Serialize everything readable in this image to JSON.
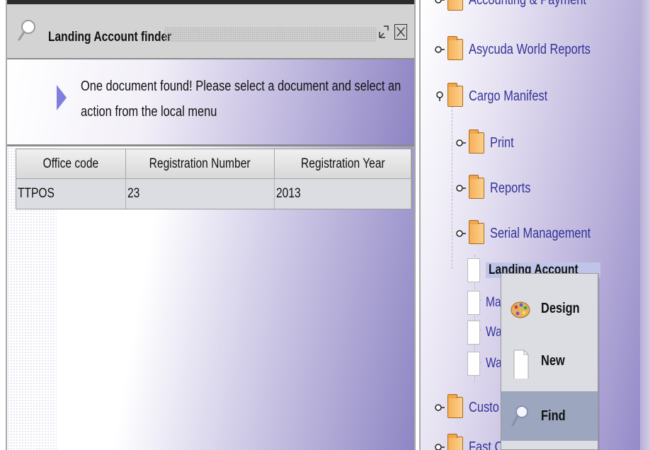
{
  "finder": {
    "title": "Landing Account finder",
    "message": "One document found! Please select a document and select an action from the local menu",
    "columns": [
      "Office code",
      "Registration Number",
      "Registration Year"
    ],
    "rows": [
      [
        "TTPOS",
        "23",
        "2013"
      ]
    ]
  },
  "tree": {
    "items": [
      {
        "label": "Accounting & Payment"
      },
      {
        "label": "Asycuda World Reports"
      },
      {
        "label": "Cargo Manifest"
      },
      {
        "label": "Print"
      },
      {
        "label": "Reports"
      },
      {
        "label": "Serial Management"
      },
      {
        "label": "Landing Account"
      },
      {
        "label": "Ma"
      },
      {
        "label": "Wa"
      },
      {
        "label": "Wa"
      },
      {
        "label": "Custo"
      },
      {
        "label": "Fast C"
      }
    ]
  },
  "context_menu": {
    "items": [
      {
        "label": "Design",
        "icon": "palette-icon"
      },
      {
        "label": "New",
        "icon": "document-icon"
      },
      {
        "label": "Find",
        "icon": "magnifier-icon",
        "highlighted": true
      }
    ]
  },
  "colors": {
    "tree_text": "#333399",
    "menu_highlight": "#9ca6be",
    "folder": "#f6b15a"
  }
}
